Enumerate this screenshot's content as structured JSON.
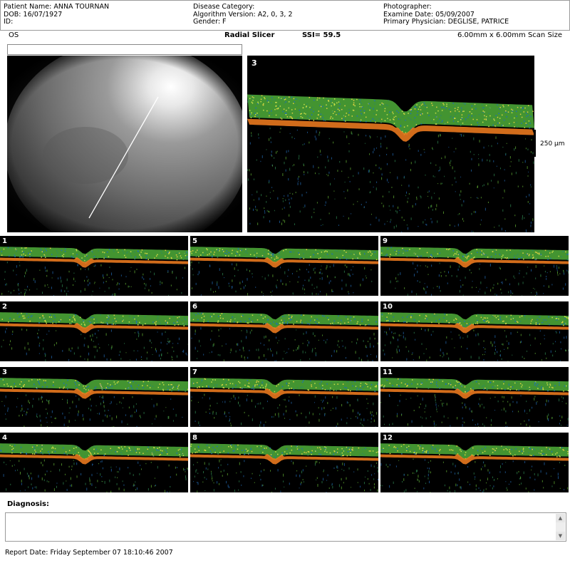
{
  "header": {
    "patient_name": "Patient Name: ANNA  TOURNAN",
    "dob": "DOB: 16/07/1927",
    "id": "ID:",
    "disease_category": "Disease Category:",
    "algorithm_version": "Algorithm Version: A2, 0, 3, 2",
    "gender": "Gender: F",
    "photographer": "Photographer:",
    "exam_date": "Examine Date: 05/09/2007",
    "physician": "Primary Physician: DEGLISE, PATRICE"
  },
  "title_line": {
    "eye": "OS",
    "mode": "Radial Slicer",
    "ssi": "SSI= 59.5",
    "scan_size": "6.00mm x 6.00mm Scan Size"
  },
  "main_scan": {
    "number": "3",
    "scale_label": "250 µm"
  },
  "tiles": [
    {
      "number": "1"
    },
    {
      "number": "5"
    },
    {
      "number": "9"
    },
    {
      "number": "2"
    },
    {
      "number": "6"
    },
    {
      "number": "10"
    },
    {
      "number": "3"
    },
    {
      "number": "7"
    },
    {
      "number": "11"
    },
    {
      "number": "4"
    },
    {
      "number": "8"
    },
    {
      "number": "12"
    }
  ],
  "diagnosis": {
    "label": "Diagnosis:",
    "value": ""
  },
  "report_date": "Report Date: Friday September 07 18:10:46 2007",
  "colors": {
    "retina_green": "#4fae3a",
    "rpe_orange": "#e8781e",
    "scan_bg": "#000000"
  }
}
